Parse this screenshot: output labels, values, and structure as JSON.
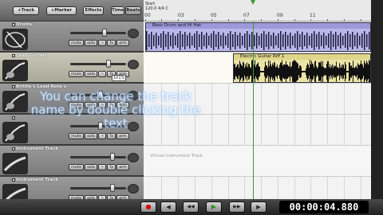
{
  "toolbar": {
    "track_btn": "+Track",
    "marker_btn": "+Marker",
    "effects_btn": "Effects",
    "time_btn": "Time",
    "beats_btn": "Beats"
  },
  "ruler": {
    "start_label": "Start",
    "tempo": "120.0 4/4 C",
    "bars": [
      "00",
      "03",
      "05",
      "07",
      "09",
      "11"
    ]
  },
  "tracks": [
    {
      "name": "Drums",
      "selected": false,
      "icon": "drum-icon",
      "vol": 0.62
    },
    {
      "name": "Lead Guitars",
      "selected": true,
      "icon": "guitar-icon",
      "vol": 0.7,
      "vol_label": "101%"
    },
    {
      "name": "Brittle's Lead Note's",
      "selected": false,
      "icon": "guitar-icon",
      "vol": 0.55
    },
    {
      "name": "",
      "selected": false,
      "icon": "guitar-icon",
      "vol": 0.55
    },
    {
      "name": "Instrument Track",
      "selected": false,
      "icon": "keyboard-icon",
      "vol": 0.78
    },
    {
      "name": "Instrument Track",
      "selected": false,
      "icon": "keyboard-icon",
      "vol": 0.78
    }
  ],
  "buttons": {
    "mute": "mute",
    "solo": "solo",
    "fx": "fx",
    "arm": "arm"
  },
  "clips": {
    "drums": "Bass Drum and Hi Hat",
    "guitar": "Electric Guitar Riff 1"
  },
  "lane_hint": "Virtual Instrument Track",
  "tooltip": "You can change the track name by double clicking the text",
  "transport": {
    "record": "●",
    "rewind": "◀",
    "fast_back": "◀◀",
    "play": "▶",
    "fast_fwd": "▶▶",
    "end": "▶",
    "time": "00:00:04.880"
  },
  "colors": {
    "drum_clip": "#b9b6ea",
    "guitar_clip": "#ece4a6",
    "playhead": "#3a9a3a"
  }
}
